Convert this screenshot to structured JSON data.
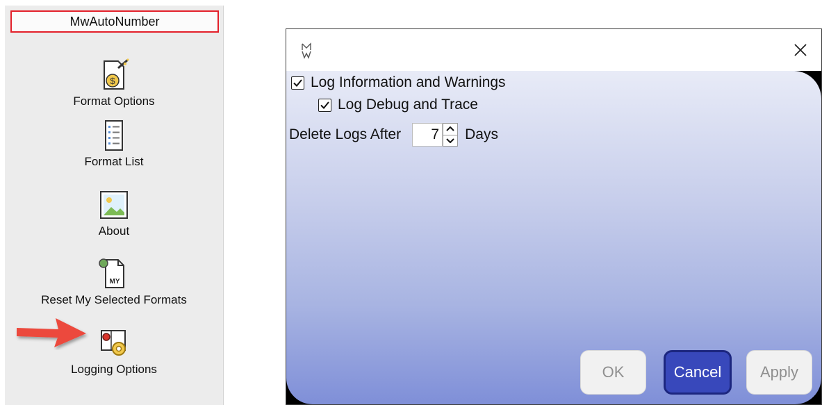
{
  "ribbon": {
    "title": "MwAutoNumber",
    "items": [
      {
        "label": "Format Options",
        "icon": "format-options-icon"
      },
      {
        "label": "Format List",
        "icon": "format-list-icon"
      },
      {
        "label": "About",
        "icon": "about-image-icon"
      },
      {
        "label": "Reset My Selected Formats",
        "icon": "reset-formats-icon"
      },
      {
        "label": "Logging Options",
        "icon": "logging-options-icon"
      }
    ],
    "annotation": "red-arrow-pointing-to-logging-options",
    "highlight_color": "#e3202a"
  },
  "dialog": {
    "log_info_label": "Log Information and Warnings",
    "log_info_checked": true,
    "log_debug_label": "Log Debug and Trace",
    "log_debug_checked": true,
    "delete_logs_label": "Delete Logs After",
    "delete_logs_value": "7",
    "days_label": "Days",
    "ok_label": "OK",
    "cancel_label": "Cancel",
    "apply_label": "Apply",
    "accent_color": "#3848bb"
  }
}
